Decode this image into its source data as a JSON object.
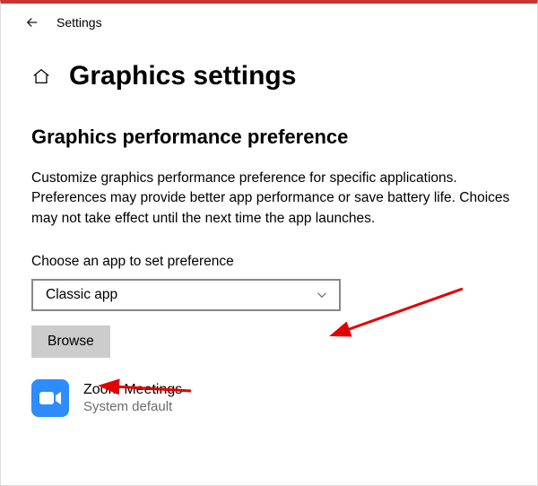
{
  "topbar": {
    "title": "Settings"
  },
  "header": {
    "title": "Graphics settings"
  },
  "main": {
    "section_title": "Graphics performance preference",
    "description": "Customize graphics performance preference for specific applications. Preferences may provide better app performance or save battery life. Choices may not take effect until the next time the app launches.",
    "choose_label": "Choose an app to set preference",
    "dropdown_value": "Classic app",
    "browse_label": "Browse"
  },
  "apps": [
    {
      "name": "Zoom Meetings",
      "preference": "System default",
      "icon": "zoom"
    }
  ]
}
